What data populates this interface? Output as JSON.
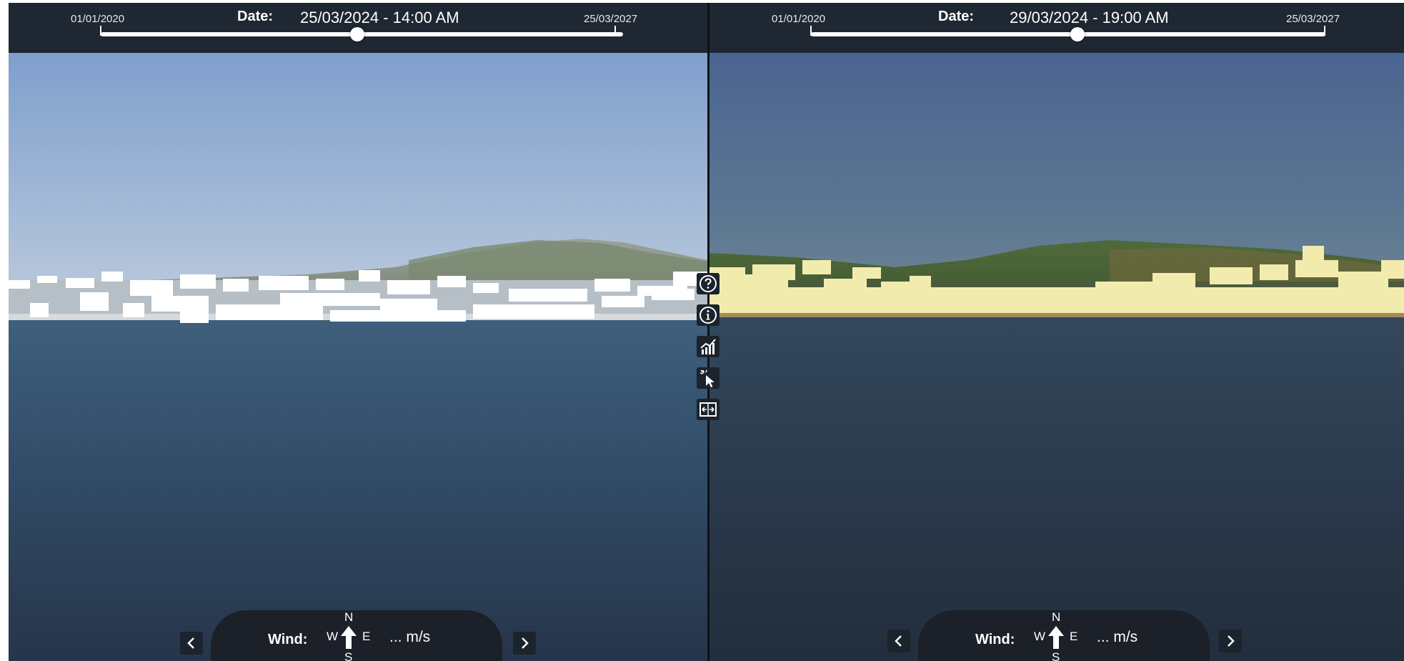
{
  "left": {
    "date_label": "Date:",
    "date_value": "25/03/2024 - 14:00 AM",
    "range_start": "01/01/2020",
    "range_end": "25/03/2027",
    "slider_position": 0.5,
    "wind": {
      "label": "Wind:",
      "north": "N",
      "south": "S",
      "west": "W",
      "east": "E",
      "value": "... m/s"
    }
  },
  "right": {
    "date_label": "Date:",
    "date_value": "29/03/2024 - 19:00 AM",
    "range_start": "01/01/2020",
    "range_end": "25/03/2027",
    "slider_position": 0.52,
    "wind": {
      "label": "Wind:",
      "north": "N",
      "south": "S",
      "west": "W",
      "east": "E",
      "value": "... m/s"
    }
  },
  "toolbar": {
    "icons": [
      "help-icon",
      "info-icon",
      "chart-icon",
      "cursor-select-icon",
      "split-view-icon"
    ]
  },
  "colors": {
    "header_bg": "#1e2732",
    "left_building": "#ffffff",
    "right_building": "#f1ecae",
    "sea_dark": "#26354a"
  }
}
